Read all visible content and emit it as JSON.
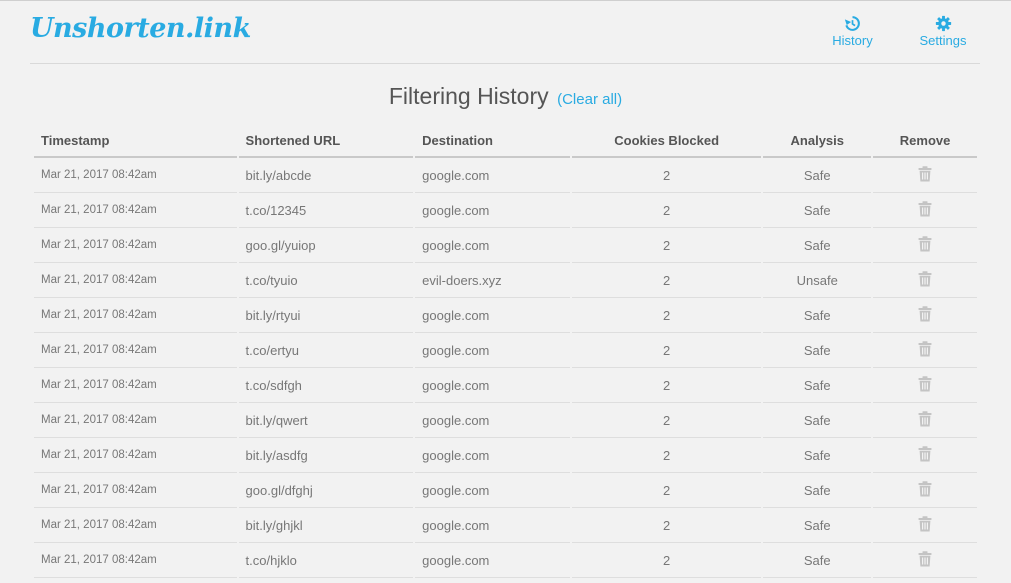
{
  "app": {
    "logo": "Unshorten.link"
  },
  "nav": {
    "history_label": "History",
    "settings_label": "Settings",
    "accent_color": "#29abe2"
  },
  "page": {
    "title": "Filtering History",
    "clear_link": "(Clear all)"
  },
  "table": {
    "headers": [
      "Timestamp",
      "Shortened URL",
      "Destination",
      "Cookies Blocked",
      "Analysis",
      "Remove"
    ],
    "rows": [
      {
        "timestamp": "Mar 21, 2017 08:42am",
        "short": "bit.ly/abcde",
        "dest": "google.com",
        "cookies": "2",
        "analysis": "Safe"
      },
      {
        "timestamp": "Mar 21, 2017 08:42am",
        "short": "t.co/12345",
        "dest": "google.com",
        "cookies": "2",
        "analysis": "Safe"
      },
      {
        "timestamp": "Mar 21, 2017 08:42am",
        "short": "goo.gl/yuiop",
        "dest": "google.com",
        "cookies": "2",
        "analysis": "Safe"
      },
      {
        "timestamp": "Mar 21, 2017 08:42am",
        "short": "t.co/tyuio",
        "dest": "evil-doers.xyz",
        "cookies": "2",
        "analysis": "Unsafe"
      },
      {
        "timestamp": "Mar 21, 2017 08:42am",
        "short": "bit.ly/rtyui",
        "dest": "google.com",
        "cookies": "2",
        "analysis": "Safe"
      },
      {
        "timestamp": "Mar 21, 2017 08:42am",
        "short": "t.co/ertyu",
        "dest": "google.com",
        "cookies": "2",
        "analysis": "Safe"
      },
      {
        "timestamp": "Mar 21, 2017 08:42am",
        "short": "t.co/sdfgh",
        "dest": "google.com",
        "cookies": "2",
        "analysis": "Safe"
      },
      {
        "timestamp": "Mar 21, 2017 08:42am",
        "short": "bit.ly/qwert",
        "dest": "google.com",
        "cookies": "2",
        "analysis": "Safe"
      },
      {
        "timestamp": "Mar 21, 2017 08:42am",
        "short": "bit.ly/asdfg",
        "dest": "google.com",
        "cookies": "2",
        "analysis": "Safe"
      },
      {
        "timestamp": "Mar 21, 2017 08:42am",
        "short": "goo.gl/dfghj",
        "dest": "google.com",
        "cookies": "2",
        "analysis": "Safe"
      },
      {
        "timestamp": "Mar 21, 2017 08:42am",
        "short": "bit.ly/ghjkl",
        "dest": "google.com",
        "cookies": "2",
        "analysis": "Safe"
      },
      {
        "timestamp": "Mar 21, 2017 08:42am",
        "short": "t.co/hjklo",
        "dest": "google.com",
        "cookies": "2",
        "analysis": "Safe"
      }
    ]
  },
  "icons": {
    "history": "history-icon",
    "settings": "gear-icon",
    "remove": "trash-icon"
  },
  "colors": {
    "safe": "#5cc15c",
    "unsafe": "#e06060"
  }
}
